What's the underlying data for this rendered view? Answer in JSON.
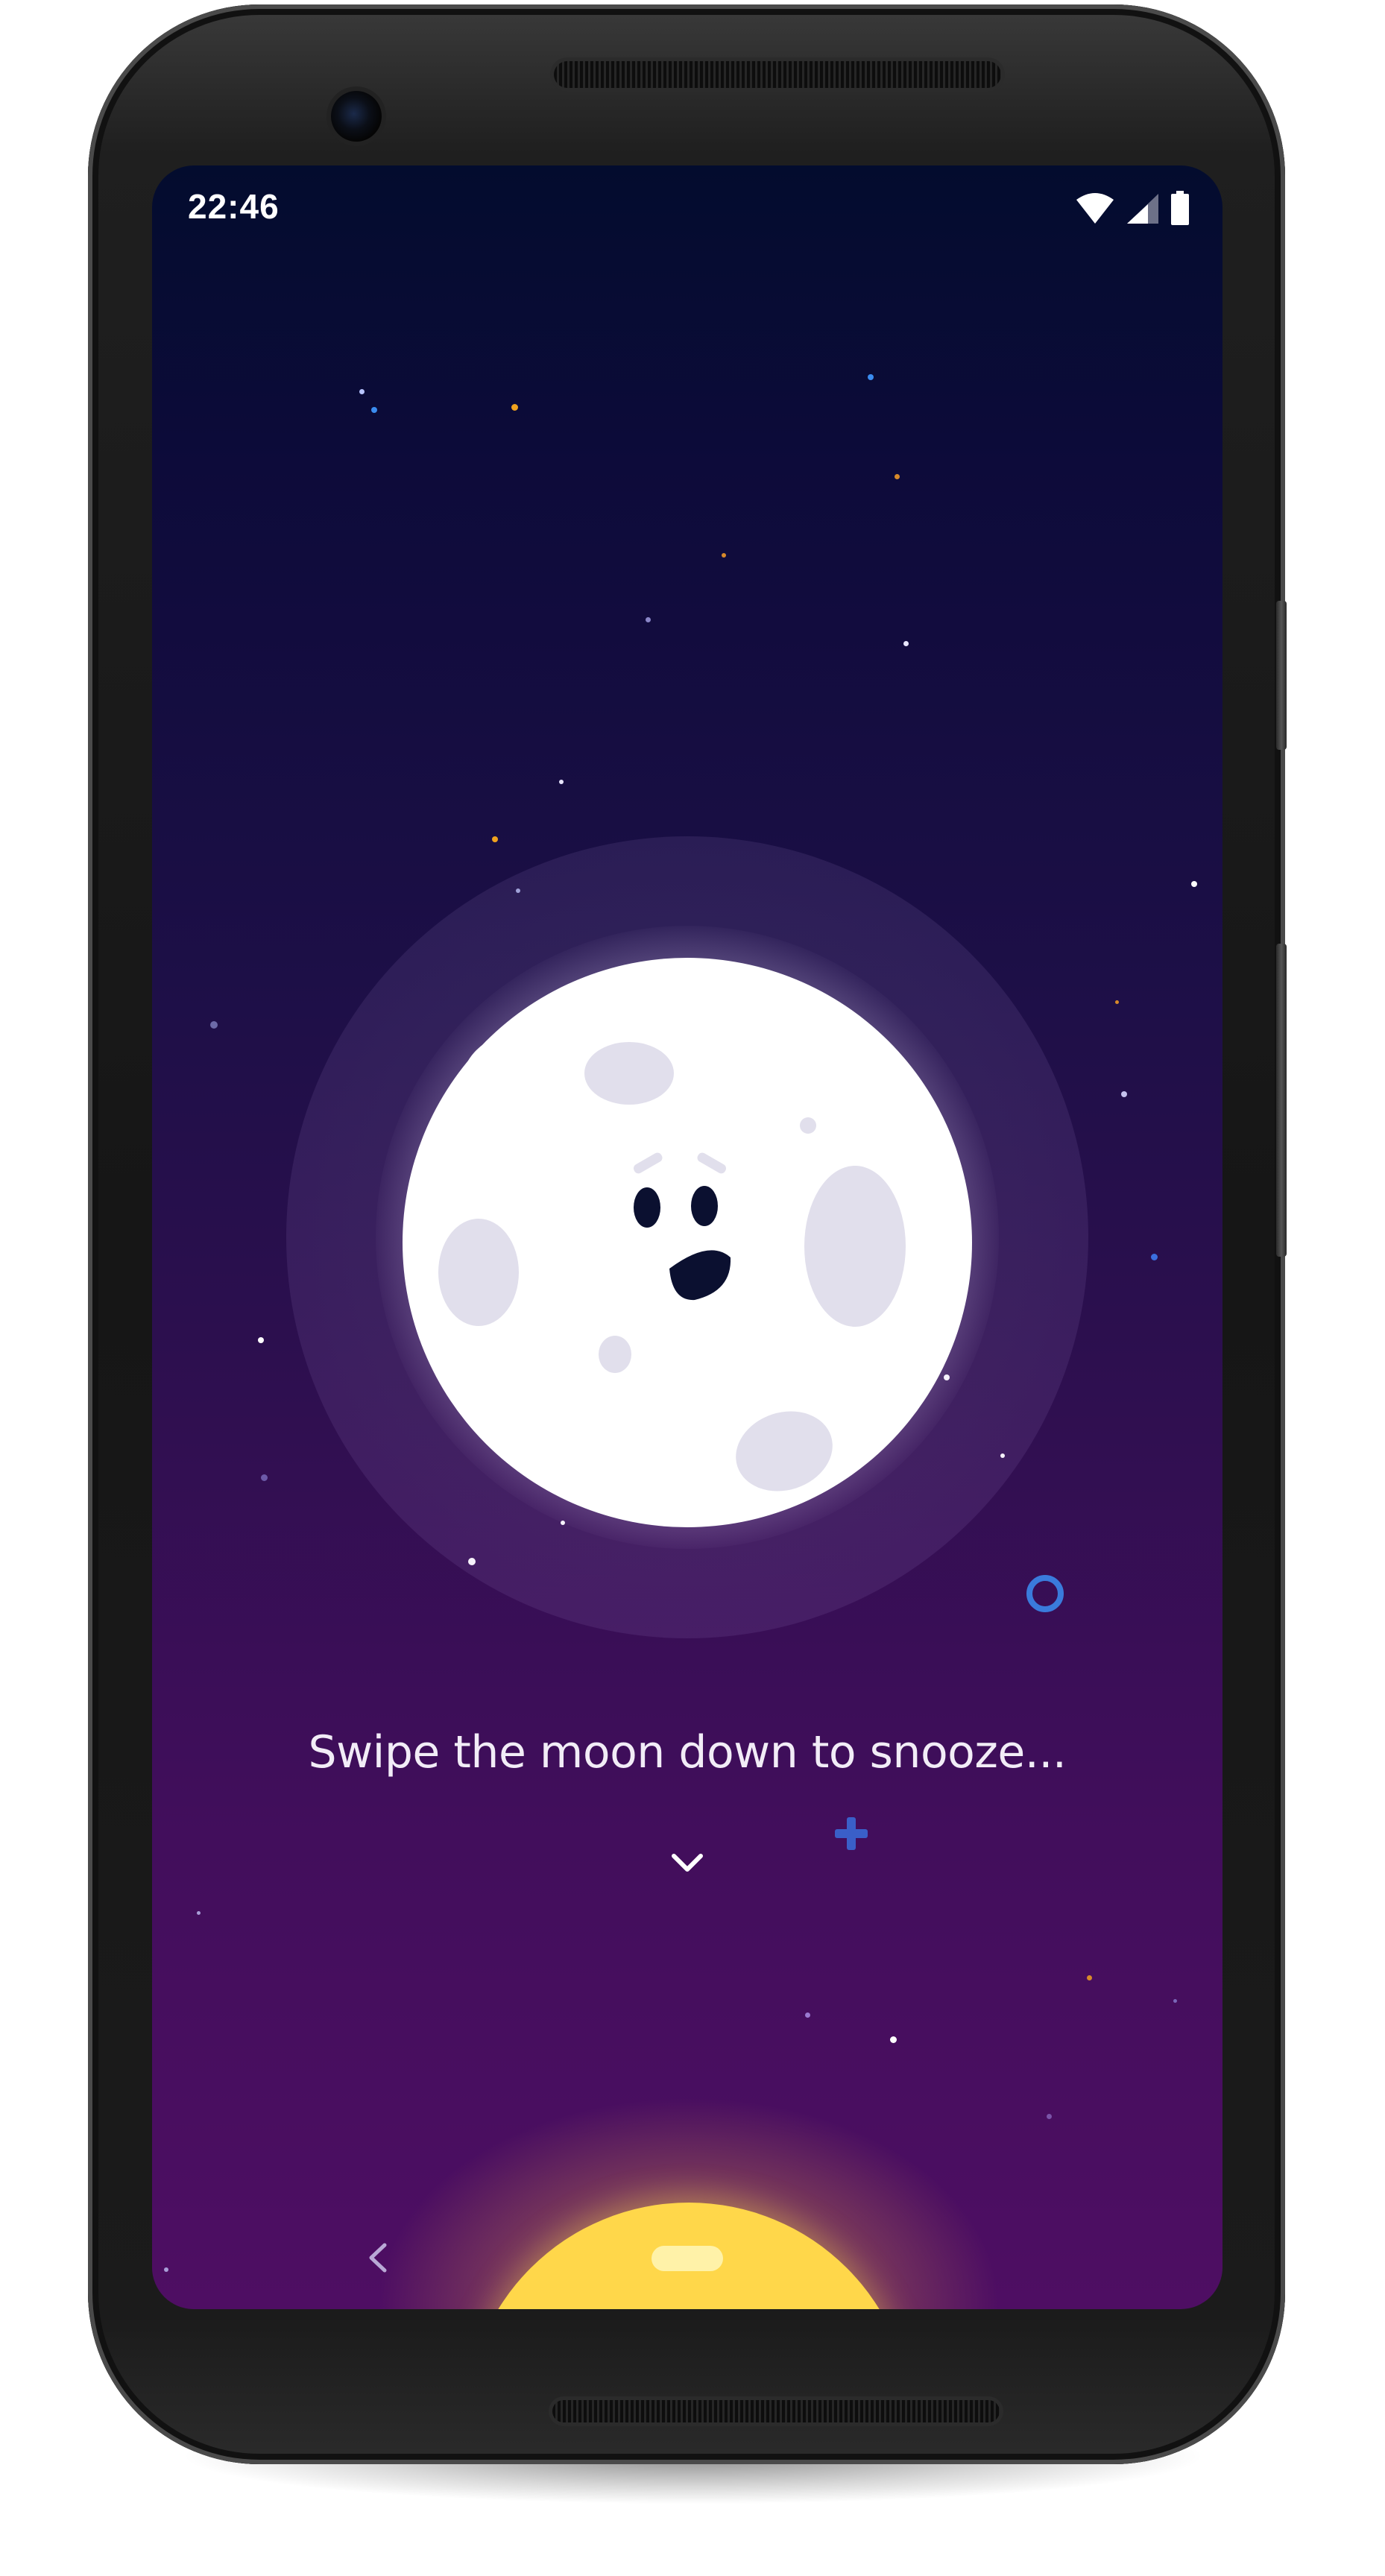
{
  "status_bar": {
    "time": "22:46",
    "icons": [
      "wifi-icon",
      "cellular-signal-icon",
      "battery-icon"
    ]
  },
  "main": {
    "instruction": "Swipe the moon down to snooze..."
  },
  "icons": {
    "swipe_indicator": "chevron-down-icon",
    "navigation_back": "back-chevron-icon",
    "navigation_home": "home-pill"
  },
  "colors": {
    "background_top": "#030c2e",
    "background_bottom": "#4e0e63",
    "moon": "#ffffff",
    "moon_craters": "#e1dfec",
    "sun": "#ffd74a",
    "accent_blue": "#3a7bdc"
  }
}
